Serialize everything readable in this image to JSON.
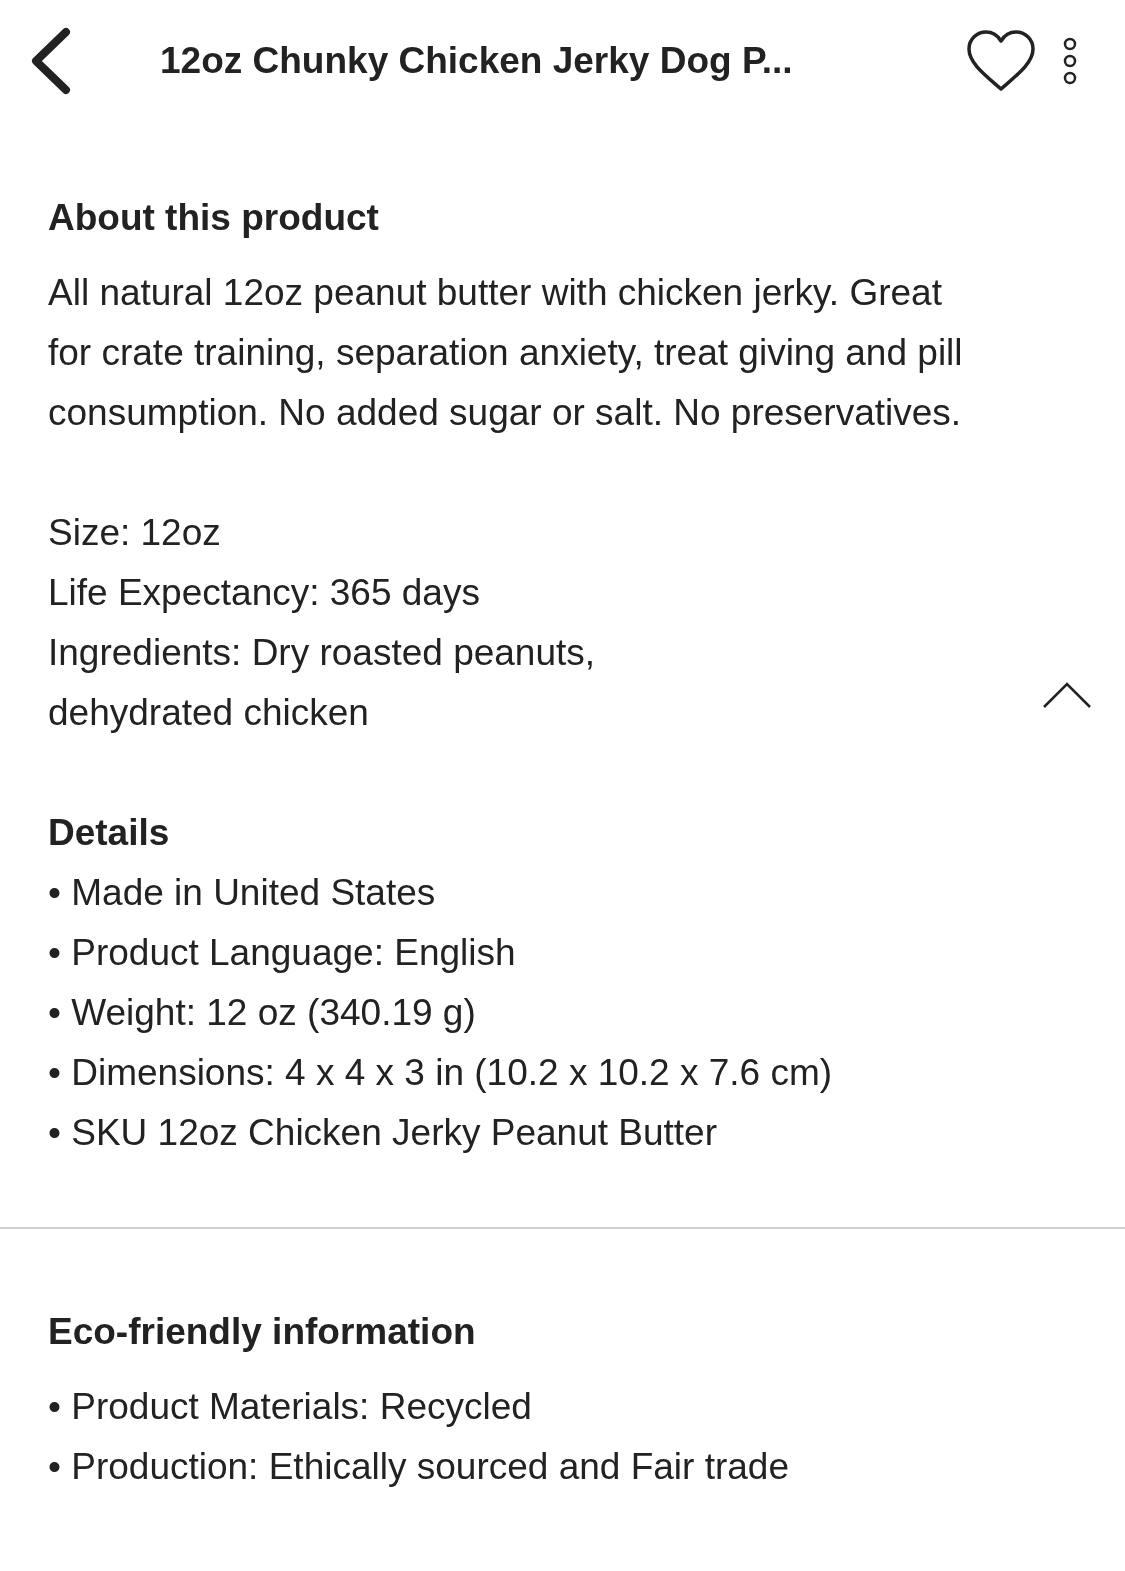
{
  "header": {
    "title": "12oz Chunky Chicken Jerky Dog P...",
    "favorited": false
  },
  "about": {
    "heading": "About this product",
    "description": "All natural 12oz peanut butter with chicken jerky. Great for crate training, separation anxiety, treat giving and pill consumption. No added sugar or salt. No preservatives.",
    "specs": [
      "Size: 12oz",
      "Life Expectancy: 365 days",
      "Ingredients: Dry roasted peanuts, dehydrated chicken"
    ],
    "expanded": true
  },
  "details": {
    "heading": "Details",
    "items": [
      "• Made in United States",
      "• Product Language: English",
      "• Weight: 12 oz (340.19 g)",
      "• Dimensions: 4 x 4 x 3 in (10.2 x 10.2 x 7.6 cm)",
      "• SKU 12oz Chicken Jerky Peanut Butter"
    ]
  },
  "eco": {
    "heading": "Eco-friendly information",
    "items": [
      "• Product Materials: Recycled",
      "• Production: Ethically sourced and Fair trade"
    ]
  }
}
